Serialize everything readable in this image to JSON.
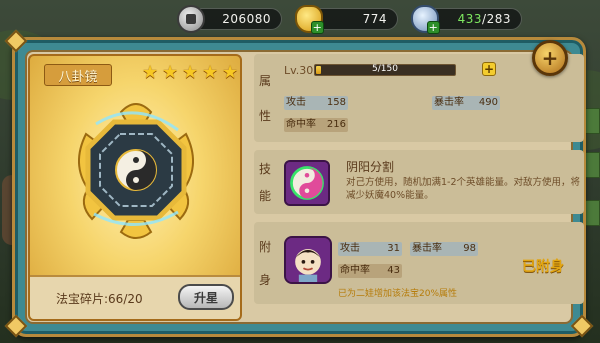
{
  "resources": {
    "coins": "206080",
    "ingots": "774",
    "energy_current": "433",
    "energy_max": "/283"
  },
  "treasure": {
    "name": "八卦镜",
    "stars": 5,
    "shards_text": "法宝碎片:66/20",
    "upgrade_label": "升星"
  },
  "attributes": {
    "section_label_1": "属",
    "section_label_2": "性",
    "level": "Lv.30",
    "exp_text": "5/150",
    "exp_progress": 0.0333,
    "stats": [
      {
        "key": "攻击",
        "value": "158"
      },
      {
        "key": "暴击率",
        "value": "490"
      },
      {
        "key": "命中率",
        "value": "216"
      }
    ]
  },
  "skill": {
    "section_label_1": "技",
    "section_label_2": "能",
    "name": "阴阳分割",
    "description": "对己方使用，随机加满1-2个英雄能量。对敌方使用，将减少妖魔40%能量。"
  },
  "attach": {
    "section_label_1": "附",
    "section_label_2": "身",
    "stats": [
      {
        "key": "攻击",
        "value": "31"
      },
      {
        "key": "暴击率",
        "value": "98"
      },
      {
        "key": "命中率",
        "value": "43"
      }
    ],
    "status": "已附身",
    "bonus": "已为二娃增加该法宝20%属性"
  },
  "colors": {
    "frame": "#3e8a92",
    "gold": "#f7c823",
    "attached": "#e2a511",
    "energy_green": "#7ee860"
  }
}
